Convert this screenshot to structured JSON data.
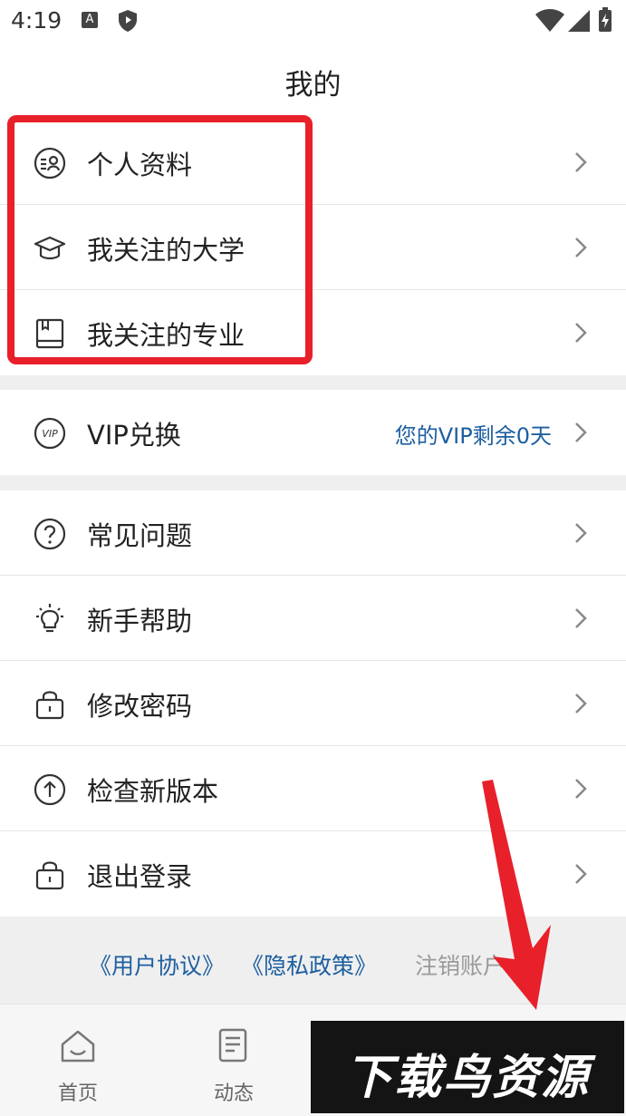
{
  "status_bar": {
    "time": "4:19",
    "a_icon_letter": "A"
  },
  "header": {
    "title": "我的"
  },
  "group1": [
    {
      "label": "个人资料",
      "icon": "profile-card-icon"
    },
    {
      "label": "我关注的大学",
      "icon": "graduation-cap-icon"
    },
    {
      "label": "我关注的专业",
      "icon": "book-icon"
    }
  ],
  "group2": [
    {
      "label": "VIP兑换",
      "icon": "vip-icon",
      "sub": "您的VIP剩余0天"
    }
  ],
  "group3": [
    {
      "label": "常见问题",
      "icon": "question-circle-icon"
    },
    {
      "label": "新手帮助",
      "icon": "lightbulb-icon"
    },
    {
      "label": "修改密码",
      "icon": "lock-icon"
    },
    {
      "label": "检查新版本",
      "icon": "upload-circle-icon"
    },
    {
      "label": "退出登录",
      "icon": "lock-icon"
    }
  ],
  "footer": {
    "user_agreement": "《用户协议》",
    "privacy_policy": "《隐私政策》",
    "cancel_account": "注销账户"
  },
  "tabs": [
    {
      "label": "首页",
      "icon": "home-icon"
    },
    {
      "label": "动态",
      "icon": "news-icon"
    }
  ],
  "watermark": "下载鸟资源",
  "colors": {
    "link": "#1d5fa0",
    "highlight": "#e8202a",
    "arrow": "#e8202a"
  }
}
